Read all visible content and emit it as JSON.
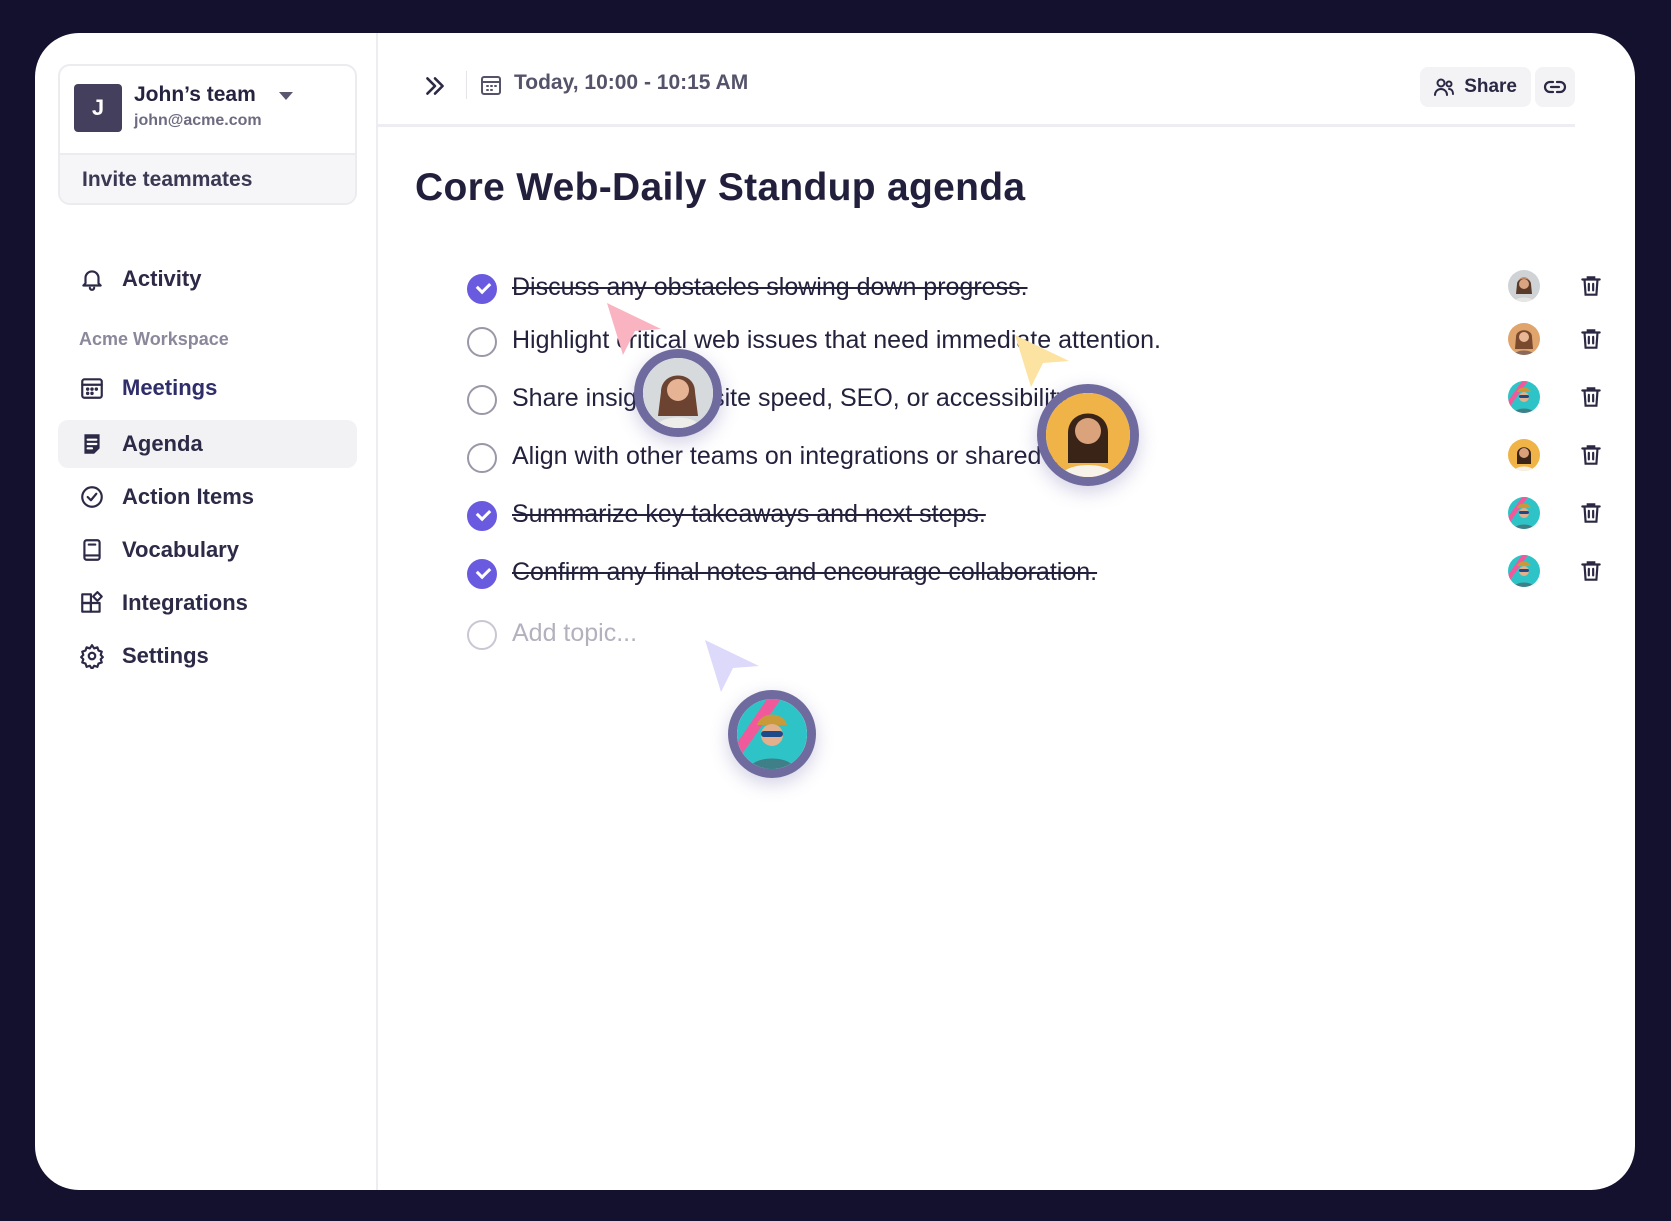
{
  "team": {
    "avatar_letter": "J",
    "name": "John’s team",
    "email": "john@acme.com",
    "invite_label": "Invite teammates"
  },
  "nav": {
    "activity": "Activity",
    "section_label": "Acme Workspace",
    "items": [
      {
        "label": "Meetings",
        "icon": "calendar-icon"
      },
      {
        "label": "Agenda",
        "icon": "agenda-icon",
        "active": true
      },
      {
        "label": "Action Items",
        "icon": "check-circle-icon"
      },
      {
        "label": "Vocabulary",
        "icon": "book-icon"
      },
      {
        "label": "Integrations",
        "icon": "puzzle-icon"
      },
      {
        "label": "Settings",
        "icon": "gear-icon"
      }
    ]
  },
  "header": {
    "meeting_time": "Today, 10:00 - 10:15 AM",
    "share_label": "Share"
  },
  "page": {
    "title": "Core Web-Daily Standup agenda",
    "add_topic_placeholder": "Add topic..."
  },
  "agenda": [
    {
      "text": "Discuss any obstacles slowing down progress.",
      "done": true
    },
    {
      "text": "Highlight critical web issues that need immediate attention.",
      "done": false
    },
    {
      "text": "Share insights on site speed, SEO, or accessibility.",
      "done": false
    },
    {
      "text": "Align with other teams on integrations or shared efforts.",
      "done": false
    },
    {
      "text": "Summarize key takeaways and next steps.",
      "done": true
    },
    {
      "text": "Confirm any final notes and encourage collaboration.",
      "done": true
    }
  ],
  "colors": {
    "background": "#13112e",
    "accent": "#6a5ae0",
    "cursor_pink": "#f8b4c0",
    "cursor_yellow": "#fde3a0",
    "cursor_lavender": "#d9d6fb"
  }
}
